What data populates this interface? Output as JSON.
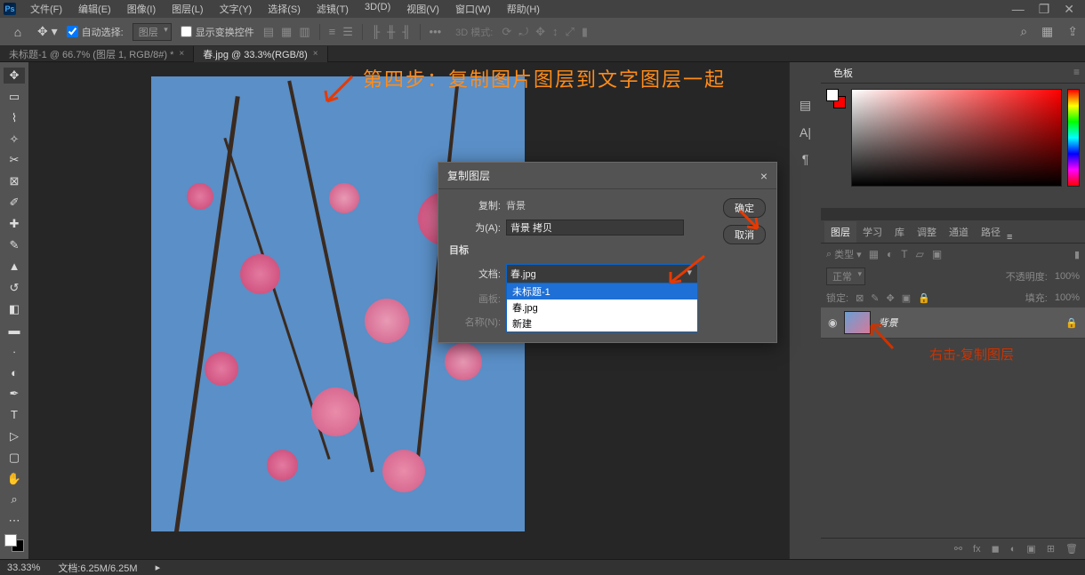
{
  "menubar": [
    "文件(F)",
    "编辑(E)",
    "图像(I)",
    "图层(L)",
    "文字(Y)",
    "选择(S)",
    "滤镜(T)",
    "3D(D)",
    "视图(V)",
    "窗口(W)",
    "帮助(H)"
  ],
  "options": {
    "auto_select": "自动选择:",
    "auto_select_type": "图层",
    "show_transform": "显示变换控件",
    "mode_3d": "3D 模式:"
  },
  "tabs": [
    {
      "label": "未标题-1 @ 66.7% (图层 1, RGB/8#) *",
      "active": false
    },
    {
      "label": "春.jpg @ 33.3%(RGB/8)",
      "active": true
    }
  ],
  "annotation": {
    "title": "第四步：复制图片图层到文字图层一起",
    "right": "右击-复制图层"
  },
  "dialog": {
    "title": "复制图层",
    "copy_label": "复制:",
    "copy_value": "背景",
    "as_label": "为(A):",
    "as_value": "背景 拷贝",
    "dest_label": "目标",
    "doc_label": "文档:",
    "doc_value": "春.jpg",
    "doc_options": [
      "未标题-1",
      "春.jpg",
      "新建"
    ],
    "artboard_label": "画板:",
    "name_label": "名称(N):",
    "ok": "确定",
    "cancel": "取消"
  },
  "panels": {
    "color_tab": "色板",
    "layer_tabs": [
      "图层",
      "学习",
      "库",
      "调整",
      "通道",
      "路径"
    ],
    "filter_label": "类型",
    "blend_mode": "正常",
    "opacity_label": "不透明度:",
    "opacity_value": "100%",
    "lock_label": "锁定:",
    "fill_label": "填充:",
    "fill_value": "100%",
    "layer": {
      "name": "背景"
    }
  },
  "status": {
    "zoom": "33.33%",
    "doc_info": "文档:6.25M/6.25M"
  }
}
